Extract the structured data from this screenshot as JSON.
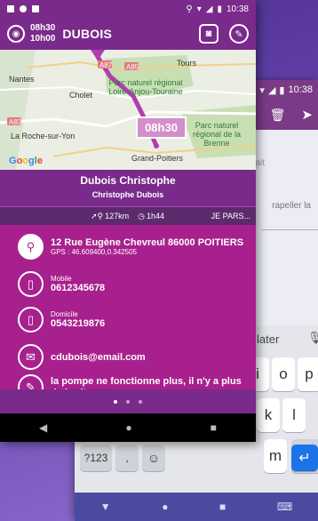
{
  "front": {
    "status": {
      "time": "10:38"
    },
    "toolbar": {
      "time_start": "08h30",
      "time_end": "10h00",
      "title": "DUBOIS"
    },
    "map": {
      "labels": {
        "nantes": "Nantes",
        "cholet": "Cholet",
        "tours": "Tours",
        "park1": "Parc naturel régional Loire-Anjou-Touraine",
        "park2": "Parc naturel régional de la Brenne",
        "larochesuryon": "La Roche-sur-Yon",
        "grandpoitiers": "Grand-Poitiers",
        "a85": "A85",
        "a83": "A83",
        "a87": "A87"
      },
      "google": [
        "G",
        "o",
        "o",
        "g",
        "l",
        "e"
      ],
      "badge": "08h30"
    },
    "client": {
      "name": "Dubois Christophe",
      "subtitle": "Christophe Dubois"
    },
    "info": {
      "distance": "127km",
      "duration": "1h44",
      "action": "JE PARS..."
    },
    "details": {
      "address": "12 Rue Eugène Chevreul 86000 POITIERS",
      "gps": "GPS : 46.609400,0.342505",
      "mobile_label": "Mobile",
      "mobile": "0612345678",
      "home_label": "Domicile",
      "home": "0543219876",
      "email": "cdubois@email.com",
      "note": "la pompe ne fonctionne plus, il n'y a plus de bruit"
    }
  },
  "back": {
    "status": {
      "time": "10:38"
    },
    "hints": {
      "top": "ait",
      "reminder": "rapeller la"
    },
    "keyboard": {
      "suggestion": "later",
      "row1": [
        "i",
        "o",
        "p"
      ],
      "row2": [
        "k",
        "l"
      ],
      "row3": [
        "m",
        "⌫"
      ],
      "bottom": [
        "?123",
        ",",
        "☺",
        ".",
        "↵"
      ]
    }
  }
}
